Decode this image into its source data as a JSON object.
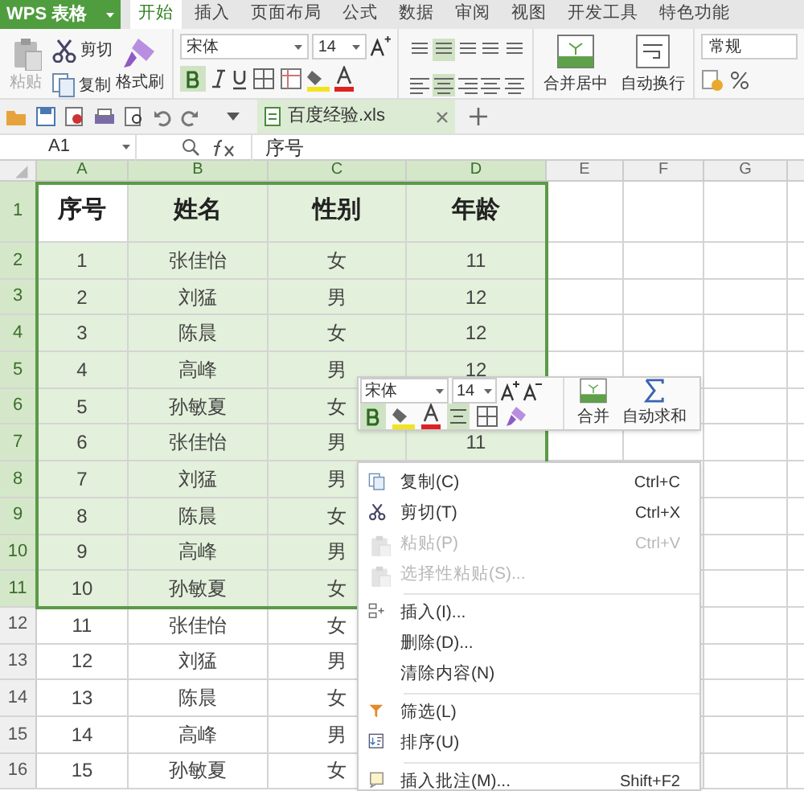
{
  "app": {
    "title": "WPS 表格"
  },
  "tabs": [
    {
      "label": "开始",
      "selected": true
    },
    {
      "label": "插入",
      "selected": false
    },
    {
      "label": "页面布局",
      "selected": false
    },
    {
      "label": "公式",
      "selected": false
    },
    {
      "label": "数据",
      "selected": false
    },
    {
      "label": "审阅",
      "selected": false
    },
    {
      "label": "视图",
      "selected": false
    },
    {
      "label": "开发工具",
      "selected": false
    },
    {
      "label": "特色功能",
      "selected": false
    }
  ],
  "ribbon": {
    "paste": "粘贴",
    "cut": "剪切",
    "copy": "复制",
    "format_painter": "格式刷",
    "font_name": "宋体",
    "font_size": "14",
    "bold": true,
    "merge": "合并居中",
    "wrap": "自动换行",
    "number_format": "常规"
  },
  "document_tabs": [
    {
      "label": "百度经验.xls",
      "selected": true
    }
  ],
  "formula_bar": {
    "cell": "A1",
    "formula": "序号"
  },
  "sheet": {
    "columns": [
      {
        "label": "A",
        "selected": true
      },
      {
        "label": "B",
        "selected": true
      },
      {
        "label": "C",
        "selected": true
      },
      {
        "label": "D",
        "selected": true
      },
      {
        "label": "E",
        "selected": false
      },
      {
        "label": "F",
        "selected": false
      },
      {
        "label": "G",
        "selected": false
      }
    ],
    "rows": [
      {
        "number": "1",
        "kind": "header",
        "selected": true,
        "cells": [
          "序号",
          "姓名",
          "性别",
          "年龄"
        ]
      },
      {
        "number": "2",
        "kind": "data",
        "selected": true,
        "cells": [
          "1",
          "张佳怡",
          "女",
          "11"
        ]
      },
      {
        "number": "3",
        "kind": "data",
        "selected": true,
        "cells": [
          "2",
          "刘猛",
          "男",
          "12"
        ]
      },
      {
        "number": "4",
        "kind": "data",
        "selected": true,
        "cells": [
          "3",
          "陈晨",
          "女",
          "12"
        ]
      },
      {
        "number": "5",
        "kind": "data",
        "selected": true,
        "cells": [
          "4",
          "高峰",
          "男",
          "12"
        ]
      },
      {
        "number": "6",
        "kind": "data",
        "selected": true,
        "cells": [
          "5",
          "孙敏夏",
          "女"
        ]
      },
      {
        "number": "7",
        "kind": "data",
        "selected": true,
        "cells": [
          "6",
          "张佳怡",
          "男",
          "11"
        ]
      },
      {
        "number": "8",
        "kind": "data",
        "selected": true,
        "cells": [
          "7",
          "刘猛",
          "男"
        ]
      },
      {
        "number": "9",
        "kind": "data",
        "selected": true,
        "cells": [
          "8",
          "陈晨",
          "女"
        ]
      },
      {
        "number": "10",
        "kind": "data",
        "selected": true,
        "cells": [
          "9",
          "高峰",
          "男"
        ]
      },
      {
        "number": "11",
        "kind": "data",
        "selected": true,
        "cells": [
          "10",
          "孙敏夏",
          "女"
        ]
      },
      {
        "number": "12",
        "kind": "data",
        "selected": false,
        "cells": [
          "11",
          "张佳怡",
          "女"
        ]
      },
      {
        "number": "13",
        "kind": "data",
        "selected": false,
        "cells": [
          "12",
          "刘猛",
          "男"
        ]
      },
      {
        "number": "14",
        "kind": "data",
        "selected": false,
        "cells": [
          "13",
          "陈晨",
          "女"
        ]
      },
      {
        "number": "15",
        "kind": "data",
        "selected": false,
        "cells": [
          "14",
          "高峰",
          "男"
        ]
      },
      {
        "number": "16",
        "kind": "data",
        "selected": false,
        "cells": [
          "15",
          "孙敏夏",
          "女"
        ]
      }
    ]
  },
  "mini_toolbar": {
    "font_name": "宋体",
    "font_size": "14",
    "bold": true,
    "merge": "合并",
    "autosum": "自动求和"
  },
  "context_menu": [
    {
      "kind": "item",
      "label": "复制(C)",
      "shortcut": "Ctrl+C",
      "disabled": false
    },
    {
      "kind": "item",
      "label": "剪切(T)",
      "shortcut": "Ctrl+X",
      "disabled": false
    },
    {
      "kind": "item",
      "label": "粘贴(P)",
      "shortcut": "Ctrl+V",
      "disabled": true
    },
    {
      "kind": "item",
      "label": "选择性粘贴(S)...",
      "disabled": true
    },
    {
      "kind": "separator"
    },
    {
      "kind": "item",
      "label": "插入(I)...",
      "disabled": false
    },
    {
      "kind": "item",
      "label": "删除(D)...",
      "disabled": false
    },
    {
      "kind": "item",
      "label": "清除内容(N)",
      "disabled": false
    },
    {
      "kind": "separator"
    },
    {
      "kind": "item",
      "label": "筛选(L)",
      "disabled": false
    },
    {
      "kind": "item",
      "label": "排序(U)",
      "disabled": false
    },
    {
      "kind": "separator"
    },
    {
      "kind": "item",
      "label": "插入批注(M)...",
      "shortcut": "Shift+F2",
      "disabled": false
    }
  ]
}
